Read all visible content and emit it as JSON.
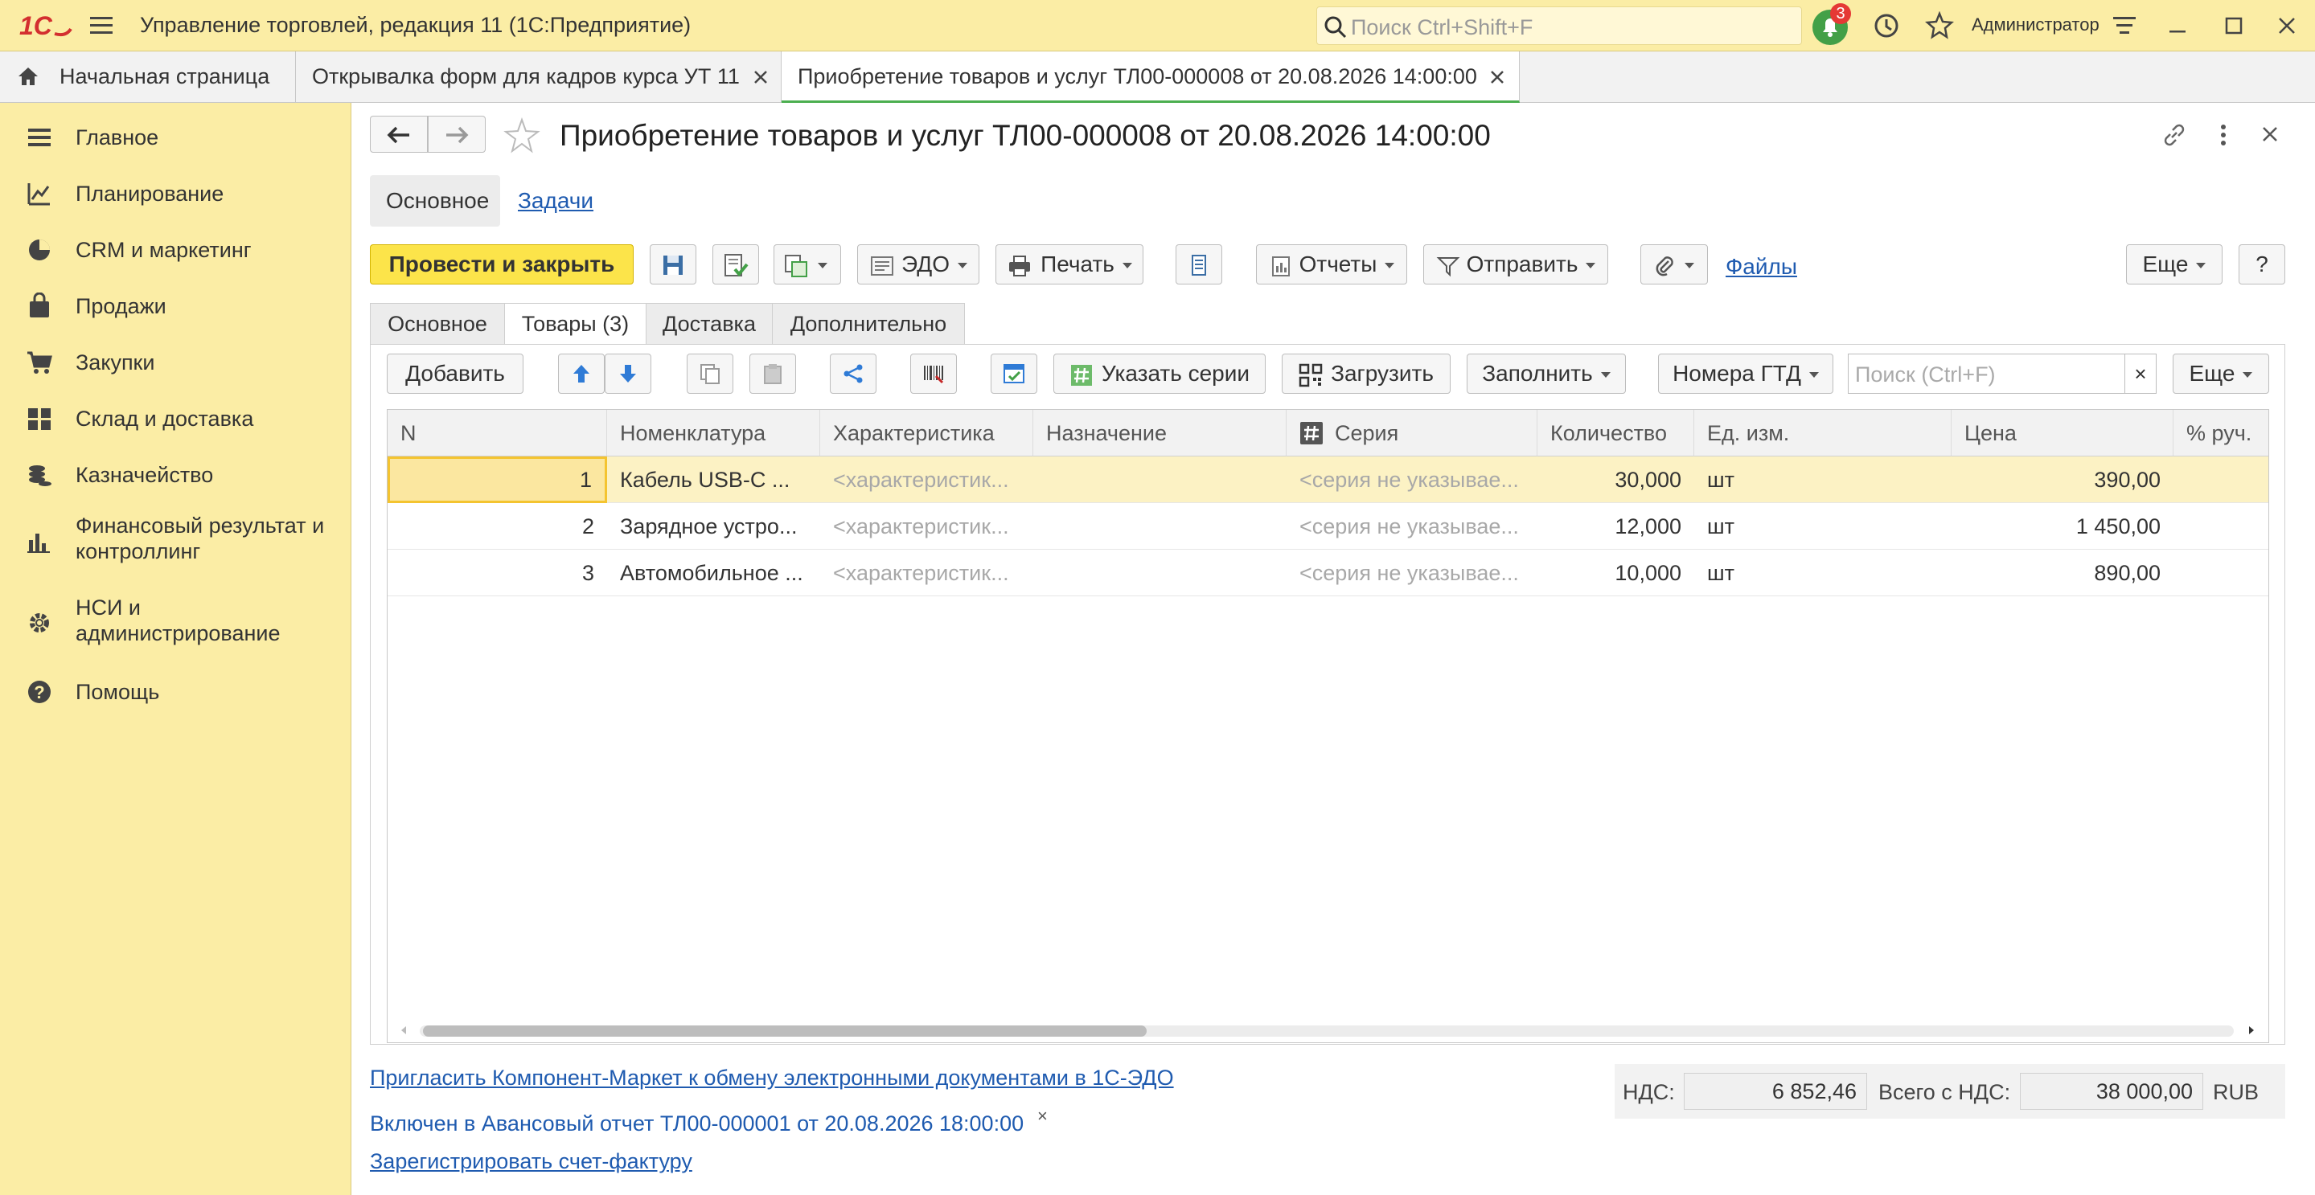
{
  "app": {
    "title": "Управление торговлей, редакция 11  (1С:Предприятие)",
    "search_placeholder": "Поиск Ctrl+Shift+F",
    "notifications_count": "3",
    "user": "Администратор"
  },
  "tabs": [
    {
      "label": "Начальная страница"
    },
    {
      "label": "Открывалка форм для кадров курса УТ 11"
    },
    {
      "label": "Приобретение товаров и услуг ТЛ00-000008 от 20.08.2026 14:00:00"
    }
  ],
  "sidebar": {
    "items": [
      {
        "label": "Главное",
        "icon": "menu-lines-icon"
      },
      {
        "label": "Планирование",
        "icon": "chart-icon"
      },
      {
        "label": "CRM и маркетинг",
        "icon": "pie-icon"
      },
      {
        "label": "Продажи",
        "icon": "bag-icon"
      },
      {
        "label": "Закупки",
        "icon": "cart-icon"
      },
      {
        "label": "Склад и доставка",
        "icon": "warehouse-icon"
      },
      {
        "label": "Казначейство",
        "icon": "coins-icon"
      },
      {
        "label": "Финансовый результат и",
        "label2": "контроллинг",
        "icon": "bars-icon"
      },
      {
        "label": "НСИ и",
        "label2": "администрирование",
        "icon": "gear-icon"
      },
      {
        "label": "Помощь",
        "icon": "help-icon"
      }
    ]
  },
  "document": {
    "title": "Приобретение товаров и услуг ТЛ00-000008 от 20.08.2026 14:00:00",
    "nav_main": "Основное",
    "nav_tasks": "Задачи"
  },
  "toolbar": {
    "post_close": "Провести и закрыть",
    "edo": "ЭДО",
    "print": "Печать",
    "reports": "Отчеты",
    "send": "Отправить",
    "files": "Файлы",
    "more": "Еще",
    "help": "?"
  },
  "form_tabs": [
    {
      "label": "Основное"
    },
    {
      "label": "Товары (3)"
    },
    {
      "label": "Доставка"
    },
    {
      "label": "Дополнительно"
    }
  ],
  "goods_toolbar": {
    "add": "Добавить",
    "series": "Указать серии",
    "load": "Загрузить",
    "fill": "Заполнить",
    "gtd": "Номера ГТД",
    "search_placeholder": "Поиск (Ctrl+F)",
    "clear": "×",
    "more": "Еще"
  },
  "table": {
    "columns": [
      "N",
      "Номенклатура",
      "Характеристика",
      "Назначение",
      "Серия",
      "Количество",
      "Ед. изм.",
      "Цена",
      "% руч."
    ],
    "rows": [
      {
        "n": "1",
        "item": "Кабель USB-C ...",
        "char": "<характеристик...",
        "purpose": "",
        "series": "<серия не указывае...",
        "qty": "30,000",
        "unit": "шт",
        "price": "390,00"
      },
      {
        "n": "2",
        "item": "Зарядное устро...",
        "char": "<характеристик...",
        "purpose": "",
        "series": "<серия не указывае...",
        "qty": "12,000",
        "unit": "шт",
        "price": "1 450,00"
      },
      {
        "n": "3",
        "item": "Автомобильное ...",
        "char": "<характеристик...",
        "purpose": "",
        "series": "<серия не указывае...",
        "qty": "10,000",
        "unit": "шт",
        "price": "890,00"
      }
    ]
  },
  "footer": {
    "invite_link": "Пригласить Компонент-Маркет к обмену электронными документами в 1С-ЭДО",
    "included_in": "Включен в Авансовый отчет ТЛ00-000001 от 20.08.2026 18:00:00",
    "close": "×",
    "register_invoice": "Зарегистрировать счет-фактуру",
    "vat_label": "НДС:",
    "vat_value": "6 852,46",
    "total_label": "Всего с НДС:",
    "total_value": "38 000,00",
    "currency": "RUB"
  },
  "colors": {
    "brand_yellow": "#fbeda5",
    "primary_button": "#fce44a",
    "link": "#1f5bb0",
    "selected_row": "#fcf2c4",
    "badge": "#e53935",
    "bell": "#43a047"
  }
}
